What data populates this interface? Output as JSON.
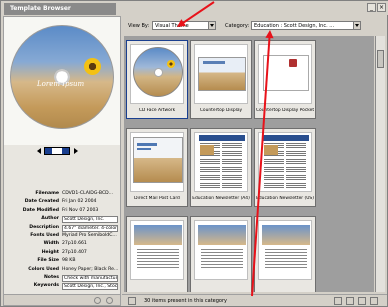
{
  "window": {
    "title": "Template Browser"
  },
  "preview": {
    "disc_text": "Lorem Ipsum",
    "pager_page": "1"
  },
  "metadata": [
    {
      "key": "Filename",
      "value": "CDVD1-CLAIDG-BCD...",
      "boxed": false
    },
    {
      "key": "Date Created",
      "value": "Fri Jan 02 2004",
      "boxed": false
    },
    {
      "key": "Date Modified",
      "value": "Fri Nov 07 2003",
      "boxed": false
    },
    {
      "key": "Author",
      "value": "Scott Design, Inc.",
      "boxed": true
    },
    {
      "key": "Description",
      "value": "4.67\" diameter. 4-color...",
      "boxed": true
    },
    {
      "key": "Fonts Used",
      "value": "Myriad Pro SemiboldC...",
      "boxed": false
    },
    {
      "key": "Width",
      "value": "27p10.661",
      "boxed": false
    },
    {
      "key": "Height",
      "value": "27p10.407",
      "boxed": false
    },
    {
      "key": "File Size",
      "value": "98 KB",
      "boxed": false
    },
    {
      "key": "Colors Used",
      "value": "Honey Paper; Black Re...",
      "boxed": false
    },
    {
      "key": "Notes",
      "value": "Check with manufacture",
      "boxed": true
    },
    {
      "key": "Keywords",
      "value": "Scott Design, Inc., Stoc...",
      "boxed": true
    }
  ],
  "toolbar": {
    "view_by_label": "View By:",
    "view_by_value": "Visual Theme",
    "category_label": "Category:",
    "category_value": "Education : Scott Design, Inc. ..."
  },
  "thumbnails": [
    {
      "caption": "CD Face Artwork",
      "kind": "cd"
    },
    {
      "caption": "Countertop Display",
      "kind": "display"
    },
    {
      "caption": "Countertop Display Pocket",
      "kind": "pocket"
    },
    {
      "caption": "Direct Mail Post Card",
      "kind": "postcard"
    },
    {
      "caption": "Education Newsletter (A4)",
      "kind": "newsletter"
    },
    {
      "caption": "Education Newsletter (US)",
      "kind": "newsletter"
    },
    {
      "caption": "",
      "kind": "flyer"
    },
    {
      "caption": "",
      "kind": "flyer"
    },
    {
      "caption": "",
      "kind": "flyer"
    }
  ],
  "status": {
    "text": "30 items present in this category"
  },
  "colors": {
    "arrow": "#e8121a",
    "selection_blue": "#1a3f8f",
    "sky_blue": "#5b8bc7",
    "wheat": "#c49a5a"
  }
}
